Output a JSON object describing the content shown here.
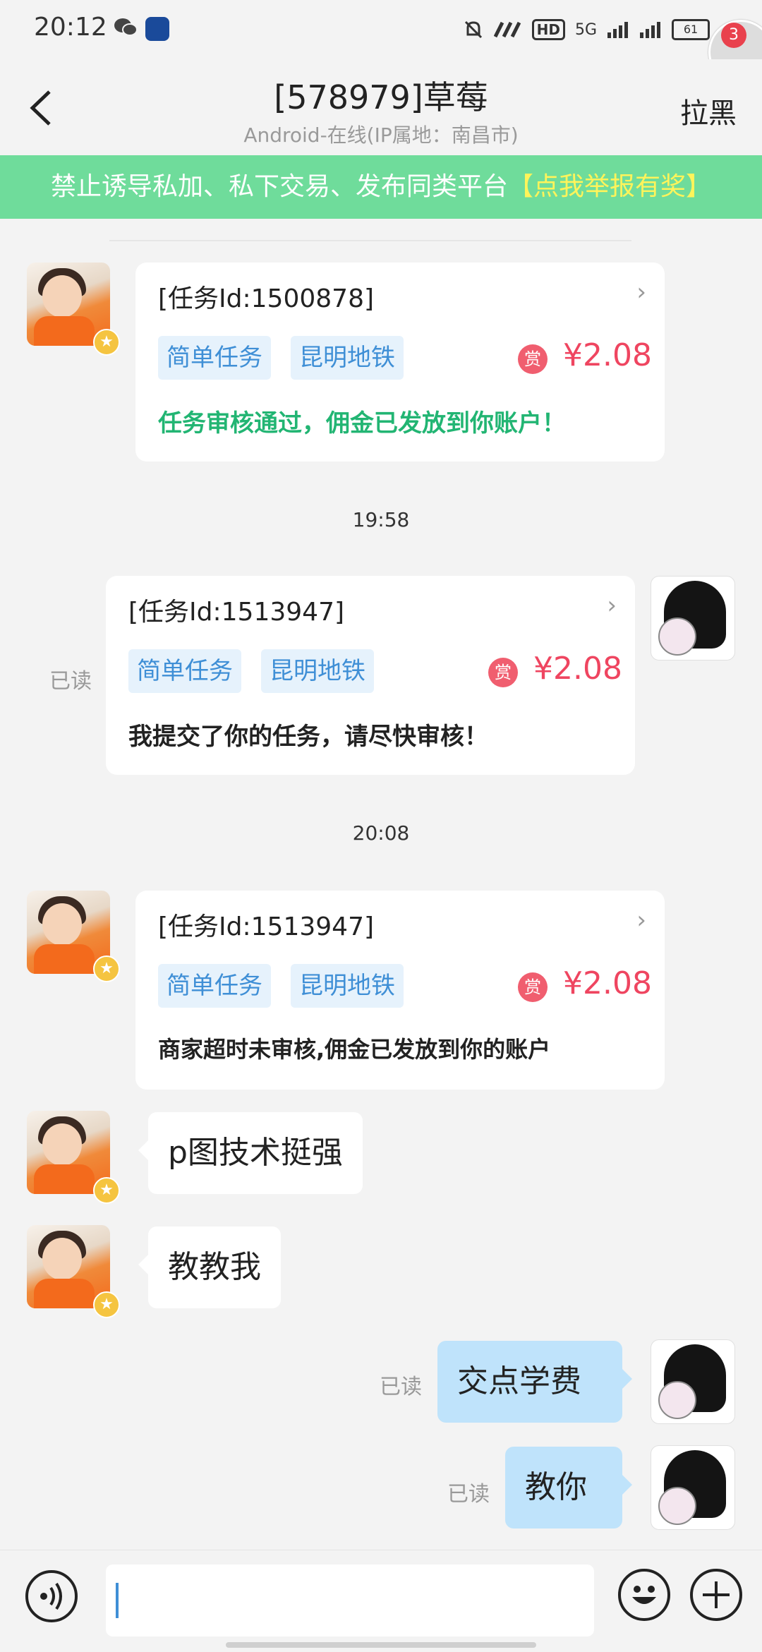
{
  "status_bar": {
    "time": "20:12",
    "network": "5G",
    "hd": "HD",
    "battery": "61",
    "float_badge": "3"
  },
  "header": {
    "title": "[578979]草莓",
    "subtitle": "Android-在线(IP属地：南昌市)",
    "block_label": "拉黑"
  },
  "notice": {
    "text": "禁止诱导私加、私下交易、发布同类平台",
    "highlight": "【点我举报有奖】"
  },
  "messages": {
    "card1": {
      "id": "[任务Id:1500878]",
      "tag1": "简单任务",
      "tag2": "昆明地铁",
      "reward_icon": "赏",
      "amount": "¥2.08",
      "status": "任务审核通过，佣金已发放到你账户！",
      "status_color": "#22b573"
    },
    "time1": "19:58",
    "card2": {
      "id": "[任务Id:1513947]",
      "tag1": "简单任务",
      "tag2": "昆明地铁",
      "reward_icon": "赏",
      "amount": "¥2.08",
      "status": "我提交了你的任务，请尽快审核！",
      "read": "已读"
    },
    "time2": "20:08",
    "card3": {
      "id": "[任务Id:1513947]",
      "tag1": "简单任务",
      "tag2": "昆明地铁",
      "reward_icon": "赏",
      "amount": "¥2.08",
      "status": "商家超时未审核,佣金已发放到你的账户"
    },
    "bubble1": "p图技术挺强",
    "bubble2": "教教我",
    "bubble3": {
      "text": "交点学费",
      "read": "已读"
    },
    "bubble4": {
      "text": "教你",
      "read": "已读"
    }
  },
  "input": {
    "placeholder": ""
  },
  "colors": {
    "notice_bg": "#6fdc9b",
    "notice_highlight": "#fff45a",
    "reward": "#ef4560",
    "tag_text": "#3f8fd6",
    "self_bubble": "#bfe3fb"
  }
}
